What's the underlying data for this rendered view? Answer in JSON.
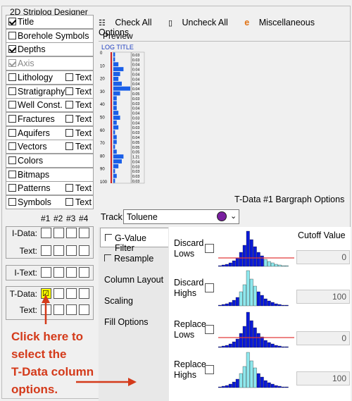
{
  "title": "2D Striplog Designer",
  "left_list": [
    {
      "label": "Title",
      "checked": true,
      "text_opt": false
    },
    {
      "label": "Borehole Symbols",
      "checked": false,
      "text_opt": false
    },
    {
      "label": "Depths",
      "checked": true,
      "text_opt": false
    },
    {
      "label": "Axis",
      "checked": true,
      "disabled": true,
      "text_opt": false
    },
    {
      "label": "Lithology",
      "checked": false,
      "text_opt": true
    },
    {
      "label": "Stratigraphy",
      "checked": false,
      "text_opt": true
    },
    {
      "label": "Well Const.",
      "checked": false,
      "text_opt": true
    },
    {
      "label": "Fractures",
      "checked": false,
      "text_opt": true
    },
    {
      "label": "Aquifers",
      "checked": false,
      "text_opt": true
    },
    {
      "label": "Vectors",
      "checked": false,
      "text_opt": true
    },
    {
      "label": "Colors",
      "checked": false,
      "text_opt": false
    },
    {
      "label": "Bitmaps",
      "checked": false,
      "text_opt": false
    },
    {
      "label": "Patterns",
      "checked": false,
      "text_opt": true
    },
    {
      "label": "Symbols",
      "checked": false,
      "text_opt": true
    }
  ],
  "text_label": "Text",
  "col_headers": [
    "#1",
    "#2",
    "#3",
    "#4"
  ],
  "grid_rows": [
    {
      "label": "I-Data:"
    },
    {
      "label": "Text:"
    },
    {
      "label": "I-Text:"
    },
    {
      "label": "T-Data:"
    },
    {
      "label": "Text:"
    }
  ],
  "toolbar": {
    "check_all": "Check All",
    "uncheck_all": "Uncheck All",
    "misc": "Miscellaneous Options"
  },
  "preview": {
    "label": "Preview",
    "log_title": "LOG TITLE",
    "depth_ticks": [
      "0",
      "10",
      "20",
      "30",
      "40",
      "50",
      "60",
      "70",
      "80",
      "90",
      "100"
    ],
    "values": [
      "0.03",
      "0.03",
      "0.04",
      "0.04",
      "0.04",
      "0.04",
      "0.04",
      "0.04",
      "0.05",
      "0.03",
      "0.03",
      "0.04",
      "0.04",
      "0.03",
      "0.04",
      "0.03",
      "0.03",
      "0.04",
      "0.05",
      "0.05",
      "0.05",
      "1.21",
      "0.04",
      "0.03",
      "0.03",
      "0.03",
      "0.03"
    ],
    "bars": [
      0.1,
      0.1,
      0.3,
      0.6,
      0.4,
      0.3,
      0.5,
      1.0,
      0.4,
      0.2,
      0.2,
      0.2,
      0.3,
      0.4,
      0.2,
      0.3,
      0.1,
      0.2,
      0.2,
      0.1,
      0.2,
      0.6,
      0.5,
      0.3,
      0.1,
      0.2,
      0.1
    ]
  },
  "options_title": "T-Data #1 Bargraph Options",
  "track": {
    "label": "Track:",
    "value": "Toluene"
  },
  "tabs": [
    {
      "label": "G-Value Filter",
      "check": true
    },
    {
      "label": "Resample",
      "check": true
    },
    {
      "label": "Column Layout",
      "check": false
    },
    {
      "label": "Scaling",
      "check": false
    },
    {
      "label": "Fill Options",
      "check": false
    }
  ],
  "filters": [
    {
      "line1": "Discard",
      "line2": "Lows",
      "cutoff": "0"
    },
    {
      "line1": "Discard",
      "line2": "Highs",
      "cutoff": "100"
    },
    {
      "line1": "Replace",
      "line2": "Lows",
      "cutoff": "0"
    },
    {
      "line1": "Replace",
      "line2": "Highs",
      "cutoff": "100"
    }
  ],
  "cutoff_label": "Cutoff Value",
  "annotation": [
    "Click here to",
    "select the",
    "T-Data column",
    "options."
  ],
  "colors": {
    "bar_blue": "#0a1ad8",
    "bar_cyan": "#8ee8ee",
    "red": "#e23a3a",
    "highlight": "#ffff00"
  }
}
